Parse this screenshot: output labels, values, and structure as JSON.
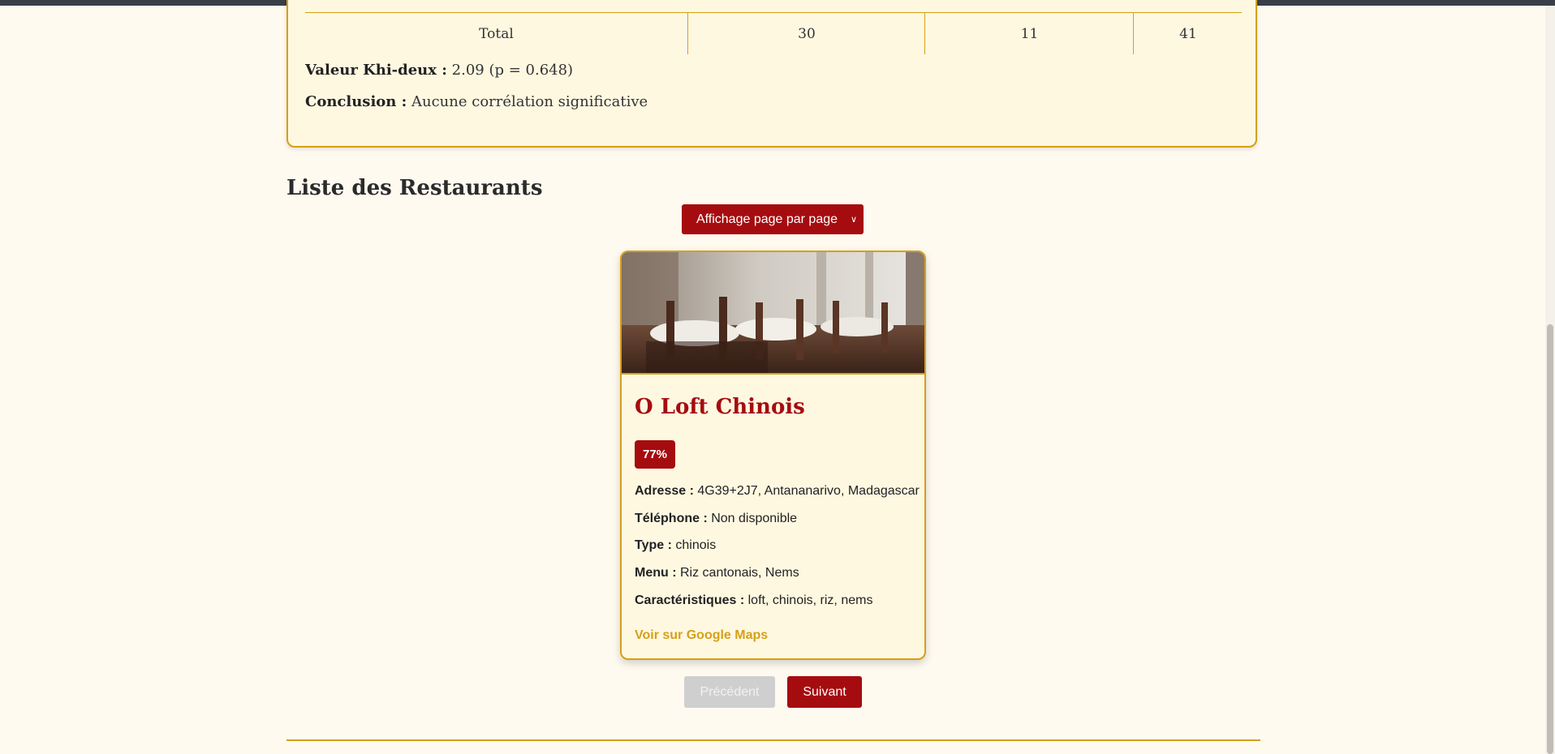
{
  "stats": {
    "total_row": [
      "Total",
      "30",
      "11",
      "41"
    ],
    "khi_label": "Valeur Khi-deux :",
    "khi_value": " 2.09 (p = 0.648)",
    "conclusion_label": "Conclusion :",
    "conclusion_value": " Aucune corrélation significative"
  },
  "section": {
    "title": "Liste des Restaurants"
  },
  "display_select": {
    "selected": "Affichage page par page"
  },
  "restaurant": {
    "name": "O Loft Chinois",
    "score": "77%",
    "address_label": "Adresse :",
    "address": " 4G39+2J7, Antananarivo, Madagascar",
    "phone_label": "Téléphone :",
    "phone": " Non disponible",
    "type_label": "Type :",
    "type": " chinois",
    "menu_label": "Menu :",
    "menu": " Riz cantonais, Nems",
    "features_label": "Caractéristiques :",
    "features": " loft, chinois, riz, nems",
    "maps_link": "Voir sur Google Maps"
  },
  "pagination": {
    "prev": "Précédent",
    "next": "Suivant"
  },
  "colors": {
    "accent": "#a50c10",
    "gold": "#d4a017",
    "background": "#fffaf0",
    "card": "#fff8e1"
  }
}
